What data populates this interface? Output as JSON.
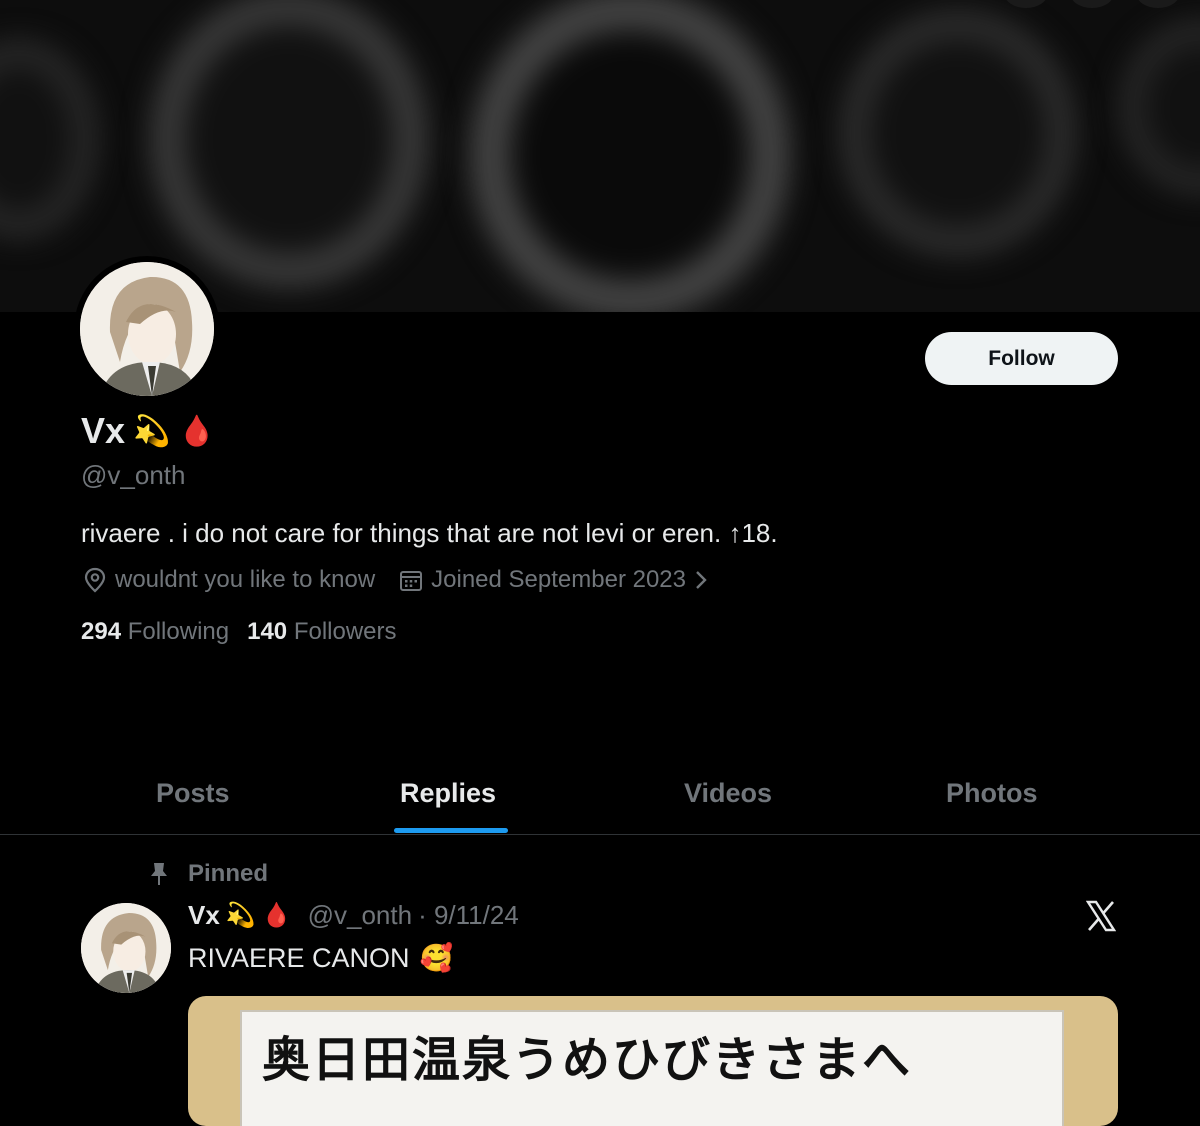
{
  "profile": {
    "name": "Vx",
    "name_emojis": [
      "💫",
      "🩸"
    ],
    "handle": "@v_onth",
    "bio": "rivaere . i do not care for things that are not levi or eren. ↑18.",
    "location": "wouldnt you like to know",
    "joined": "Joined September 2023",
    "following_count": "294",
    "following_label": "Following",
    "followers_count": "140",
    "followers_label": "Followers",
    "follow_label": "Follow"
  },
  "tabs": [
    {
      "label": "Posts",
      "active": false
    },
    {
      "label": "Replies",
      "active": true
    },
    {
      "label": "Videos",
      "active": false
    },
    {
      "label": "Photos",
      "active": false
    }
  ],
  "pinned_post": {
    "pinned_label": "Pinned",
    "name": "Vx",
    "name_emojis": [
      "💫",
      "🩸"
    ],
    "handle": "@v_onth",
    "date": "· 9/11/24",
    "text": "RIVAERE CANON",
    "text_emoji": "🥰",
    "media_caption": "奥日田温泉うめひびきさまへ"
  },
  "icons": {
    "location": "location-pin-icon",
    "calendar": "calendar-icon",
    "chevron": "chevron-right-icon",
    "pin": "pin-icon",
    "x_logo": "x-logo-icon"
  },
  "colors": {
    "accent": "#1d9bf0",
    "text_primary": "#e7e9ea",
    "text_secondary": "#71767b",
    "background": "#000000"
  }
}
